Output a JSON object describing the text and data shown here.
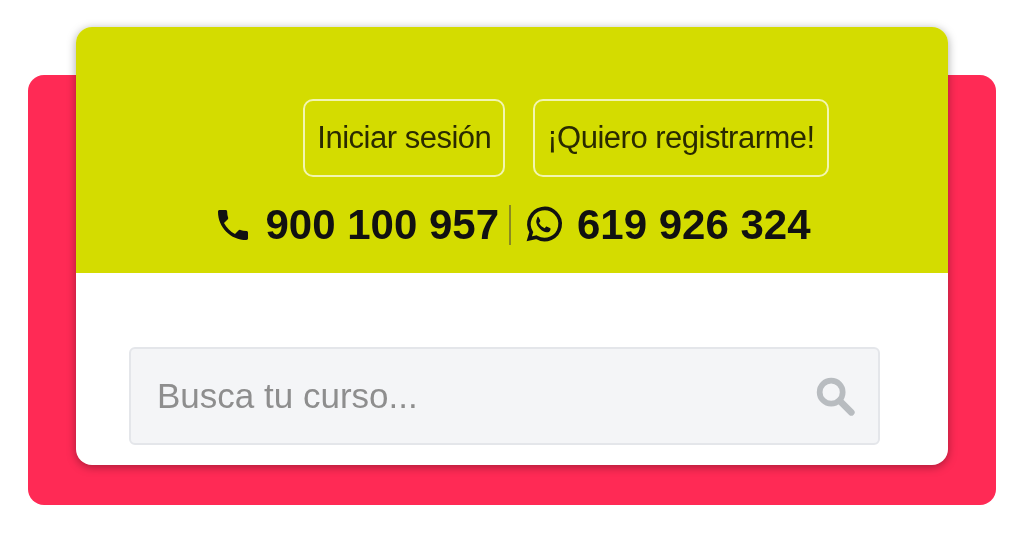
{
  "header": {
    "buttons": [
      {
        "label": "Iniciar sesión"
      },
      {
        "label": "¡Quiero registrarme!"
      }
    ],
    "phones": [
      {
        "kind": "phone",
        "number": "900 100 957"
      },
      {
        "kind": "whatsapp",
        "number": "619 926 324"
      }
    ]
  },
  "search": {
    "placeholder": "Busca tu curso..."
  }
}
